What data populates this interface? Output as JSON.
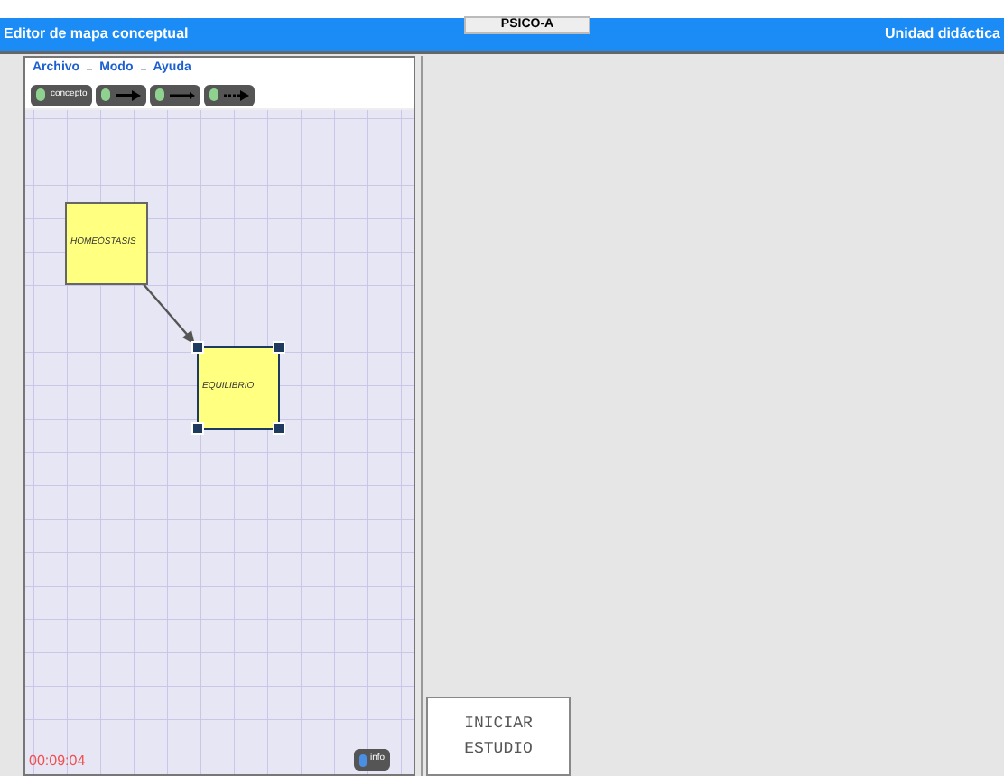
{
  "window": {
    "title": "Editor de mapa conceptual",
    "tab": "PSICO-A",
    "right_title": "Unidad didáctica"
  },
  "menu": [
    "Archivo",
    "Modo",
    "Ayuda"
  ],
  "tools": [
    {
      "kind": "text",
      "label": "concepto"
    },
    {
      "kind": "arrow"
    },
    {
      "kind": "arrow-short"
    },
    {
      "kind": "arrow-dotted"
    }
  ],
  "nodes": [
    {
      "label": "HOMEÓSTASIS",
      "selected": false
    },
    {
      "label": "EQUILIBRIO",
      "selected": true
    }
  ],
  "timer": "00:09:04",
  "info_button": "info",
  "start_button": "INICIAR ESTUDIO"
}
